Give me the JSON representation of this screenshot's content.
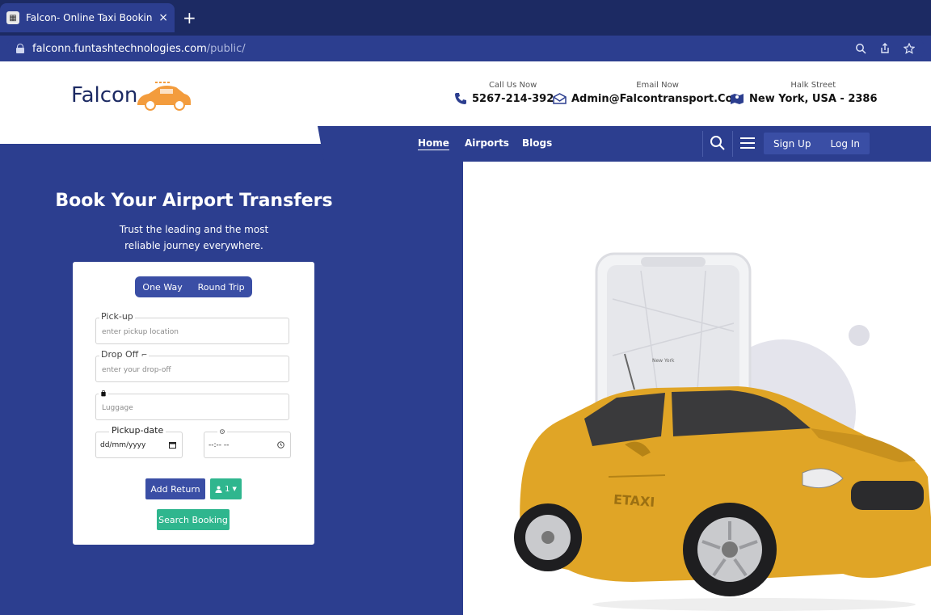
{
  "browser": {
    "tab_title": "Falcon- Online Taxi Booking S",
    "tab_close": "×",
    "new_tab": "+",
    "url_host": "falconn.funtashtechnologies.com",
    "url_path": "/public/"
  },
  "header": {
    "logo_text": "Falcon",
    "call": {
      "label": "Call Us Now",
      "value": "5267-214-392"
    },
    "email": {
      "label": "Email Now",
      "value": "Admin@Falcontransport.Com"
    },
    "address": {
      "label": "Halk Street",
      "value": "New York, USA - 2386"
    }
  },
  "nav": {
    "links": [
      "Home",
      "Airports",
      "Blogs"
    ],
    "sign_up": "Sign Up",
    "log_in": "Log In"
  },
  "hero": {
    "title": "Book Your Airport Transfers",
    "subtitle_line1": "Trust the leading and the most",
    "subtitle_line2": "reliable journey everywhere."
  },
  "booking": {
    "trip_types": [
      "One Way",
      "Round Trip"
    ],
    "pickup_label": "Pick-up",
    "pickup_placeholder": "enter pickup location",
    "dropoff_label": "Drop Off",
    "dropoff_placeholder": "enter your drop-off",
    "luggage_placeholder": "Luggage",
    "date_label": "Pickup-date",
    "date_value": "dd/mm/yyyy",
    "time_value": "--:-- --",
    "add_return": "Add Return",
    "passengers": "1",
    "search": "Search Booking"
  },
  "hero_image": {
    "car_sign": "ETAXI",
    "map_city": "New York"
  },
  "colors": {
    "primary": "#2c3e8f",
    "chrome_dark": "#1c2a63",
    "accent_green": "#2fb68e",
    "car_yellow": "#e0a526"
  }
}
